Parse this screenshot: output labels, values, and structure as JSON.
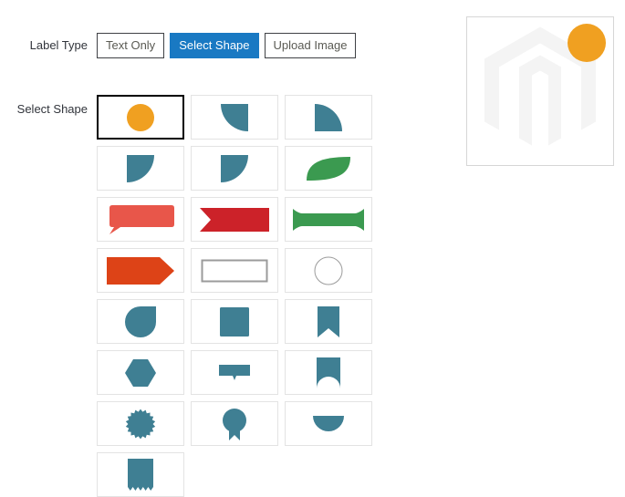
{
  "colors": {
    "orange": "#f0a021",
    "teal": "#3f7f93",
    "salmon": "#e8564a",
    "red": "#cc2229",
    "green": "#3b9a50",
    "orange_red": "#dd4317",
    "outline_gray": "#9b9b9b",
    "active_blue": "#1979c3",
    "cell_border": "#e3e3e3",
    "watermark": "#f4f4f4",
    "label_text": "#31343b"
  },
  "fields": {
    "label_type": {
      "label": "Label Type",
      "options": [
        {
          "id": "text-only",
          "label": "Text Only",
          "active": false
        },
        {
          "id": "select-shape",
          "label": "Select Shape",
          "active": true
        },
        {
          "id": "upload-image",
          "label": "Upload Image",
          "active": false
        }
      ]
    },
    "select_shape": {
      "label": "Select Shape",
      "selected_index": 0,
      "shapes": [
        {
          "index": 0,
          "name": "circle-filled",
          "color": "#f0a021",
          "selected": true
        },
        {
          "index": 1,
          "name": "quarter-circle-bottom-left",
          "color": "#3f7f93",
          "selected": false
        },
        {
          "index": 2,
          "name": "quarter-circle-top-left",
          "color": "#3f7f93",
          "selected": false
        },
        {
          "index": 3,
          "name": "quarter-circle-bottom-right",
          "color": "#3f7f93",
          "selected": false
        },
        {
          "index": 4,
          "name": "quarter-circle-top-right",
          "color": "#3f7f93",
          "selected": false
        },
        {
          "index": 5,
          "name": "leaf",
          "color": "#3b9a50",
          "selected": false
        },
        {
          "index": 6,
          "name": "speech-bubble",
          "color": "#e8564a",
          "selected": false
        },
        {
          "index": 7,
          "name": "ribbon-notch-left",
          "color": "#cc2229",
          "selected": false
        },
        {
          "index": 8,
          "name": "banner-concave",
          "color": "#3b9a50",
          "selected": false
        },
        {
          "index": 9,
          "name": "arrow-tag-right",
          "color": "#dd4317",
          "selected": false
        },
        {
          "index": 10,
          "name": "rectangle-outline",
          "color": "#9b9b9b",
          "selected": false
        },
        {
          "index": 11,
          "name": "circle-outline",
          "color": "#9b9b9b",
          "selected": false
        },
        {
          "index": 12,
          "name": "droplet",
          "color": "#3f7f93",
          "selected": false
        },
        {
          "index": 13,
          "name": "square",
          "color": "#3f7f93",
          "selected": false
        },
        {
          "index": 14,
          "name": "bookmark-notch",
          "color": "#3f7f93",
          "selected": false
        },
        {
          "index": 15,
          "name": "hexagon",
          "color": "#3f7f93",
          "selected": false
        },
        {
          "index": 16,
          "name": "callout-bar",
          "color": "#3f7f93",
          "selected": false
        },
        {
          "index": 17,
          "name": "bookmark-arc",
          "color": "#3f7f93",
          "selected": false
        },
        {
          "index": 18,
          "name": "scalloped-circle-seal",
          "color": "#3f7f93",
          "selected": false
        },
        {
          "index": 19,
          "name": "award-badge",
          "color": "#3f7f93",
          "selected": false
        },
        {
          "index": 20,
          "name": "half-circle-bottom",
          "color": "#3f7f93",
          "selected": false
        },
        {
          "index": 21,
          "name": "receipt-zigzag",
          "color": "#3f7f93",
          "selected": false
        }
      ]
    }
  },
  "preview": {
    "watermark_name": "magento-logo-watermark",
    "badge_name": "shape-preview-badge",
    "badge_shape": "circle-filled",
    "badge_color": "#f0a021"
  }
}
